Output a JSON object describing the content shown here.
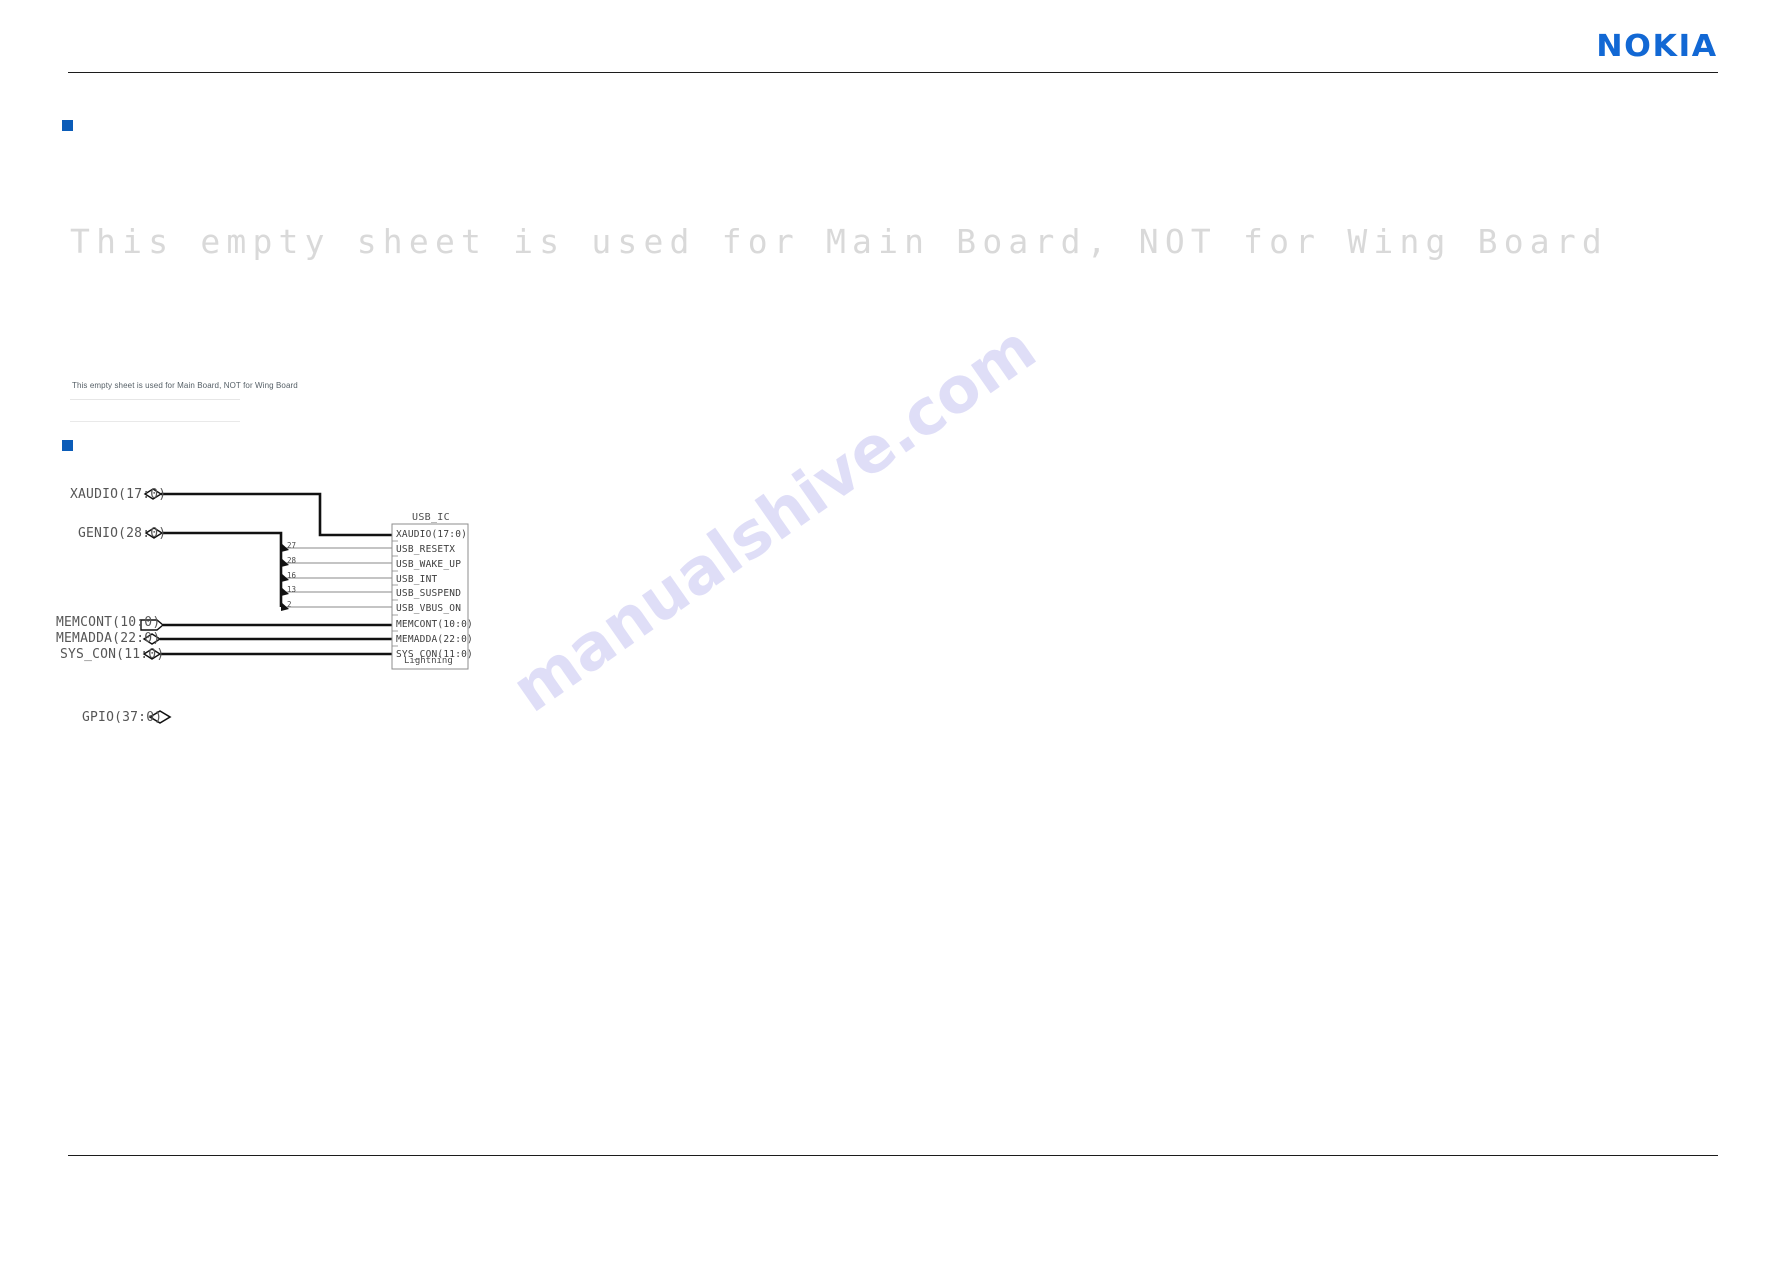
{
  "header": {
    "brand": "NOKIA",
    "brand_color": "#1268d4"
  },
  "watermark": {
    "text": "manualshive.com",
    "color": "#9691e6"
  },
  "section_one": {
    "bullet_color": "#0b5cb8",
    "faint_title": "This empty sheet is used for Main Board, NOT for Wing Board",
    "caption": "This empty sheet is used for Main Board, NOT for Wing Board"
  },
  "section_two": {
    "bullet_color": "#0b5cb8"
  },
  "schematic": {
    "ic_name": "USB_IC",
    "ic_footer": "Lightning",
    "left_signals": [
      {
        "label": "XAUDIO(17:0)",
        "shape": "bus-diamond"
      },
      {
        "label": "GENIO(28:0)",
        "shape": "bus-diamond"
      },
      {
        "label": "MEMCONT(10:0)",
        "shape": "bus-arrow"
      },
      {
        "label": "MEMADDA(22:0)",
        "shape": "bus-diamond"
      },
      {
        "label": "SYS_CON(11:0)",
        "shape": "bus-diamond"
      },
      {
        "label": "GPIO(37:0)",
        "shape": "bus-diamond"
      }
    ],
    "pins": [
      {
        "name": "XAUDIO(17:0)",
        "bit": ""
      },
      {
        "name": "USB_RESETX",
        "bit": "27"
      },
      {
        "name": "USB_WAKE_UP",
        "bit": "28"
      },
      {
        "name": "USB_INT",
        "bit": "16"
      },
      {
        "name": "USB_SUSPEND",
        "bit": "13"
      },
      {
        "name": "USB_VBUS_ON",
        "bit": "2"
      },
      {
        "name": "MEMCONT(10:0)",
        "bit": ""
      },
      {
        "name": "MEMADDA(22:0)",
        "bit": ""
      },
      {
        "name": "SYS_CON(11:0)",
        "bit": ""
      }
    ]
  }
}
